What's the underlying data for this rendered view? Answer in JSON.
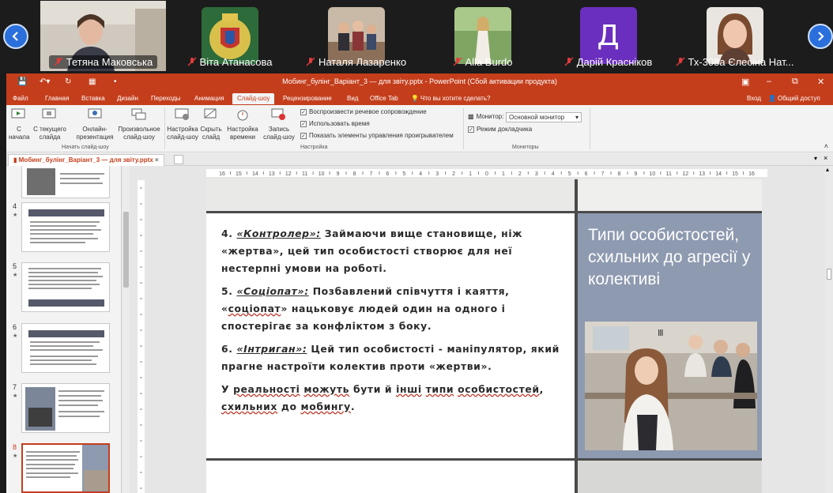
{
  "participants": [
    {
      "name": "Тетяна Маковська",
      "type": "video"
    },
    {
      "name": "Віта Атанасова",
      "type": "image"
    },
    {
      "name": "Наталя Лазаренко",
      "type": "image"
    },
    {
      "name": "Alla Burdo",
      "type": "image"
    },
    {
      "name": "Дарій Красніков",
      "type": "initial",
      "initial": "Д",
      "color": "#6b2fbf"
    },
    {
      "name": "Тх-308а Єлесіна Нат...",
      "type": "image"
    }
  ],
  "window": {
    "title": "Мобинг_булінг_Варіант_3 — для звіту.pptx - PowerPoint (Сбой активации продукта)",
    "accent": "#c43e1c"
  },
  "tabs": [
    "Файл",
    "Главная",
    "Вставка",
    "Дизайн",
    "Переходы",
    "Анимация",
    "Слайд-шоу",
    "Рецензирование",
    "Вид",
    "Office Tab"
  ],
  "active_tab": "Слайд-шоу",
  "tell_me": "Что вы хотите сделать?",
  "sign_in": "Вход",
  "share": "Общий доступ",
  "ribbon": {
    "from_start": "С начала",
    "from_start_l1": "С",
    "from_start_l2": "начала",
    "from_current_l1": "С текущего",
    "from_current_l2": "слайда",
    "online_l1": "Онлайн-",
    "online_l2": "презентация",
    "custom_l1": "Произвольное",
    "custom_l2": "слайд-шоу",
    "group_start": "Начать слайд-шоу",
    "setup_l1": "Настройка",
    "setup_l2": "слайд-шоу",
    "hide_l1": "Скрыть",
    "hide_l2": "слайд",
    "rehearse_l1": "Настройка",
    "rehearse_l2": "времени",
    "record_l1": "Запись",
    "record_l2": "слайд-шоу",
    "opt1": "Воспроизвести речевое сопровождение",
    "opt2": "Использовать время",
    "opt3": "Показать элементы управления проигрывателем",
    "group_setup": "Настройка",
    "monitor_label": "Монитор:",
    "monitor_value": "Основной монитор",
    "presenter": "Режим докладчика",
    "group_monitors": "Мониторы"
  },
  "doc_tab": "Мобинг_булінг_Варіант_3 — для звіту.pptx",
  "thumbnails": [
    {
      "num": "4",
      "selected": false
    },
    {
      "num": "5",
      "selected": false
    },
    {
      "num": "6",
      "selected": false
    },
    {
      "num": "7",
      "selected": false
    },
    {
      "num": "8",
      "selected": true
    }
  ],
  "ruler": [
    "16",
    "15",
    "14",
    "13",
    "12",
    "11",
    "10",
    "9",
    "8",
    "7",
    "6",
    "5",
    "4",
    "3",
    "2",
    "1",
    "0",
    "1",
    "2",
    "3",
    "4",
    "5",
    "6",
    "7",
    "8",
    "9",
    "10",
    "11",
    "12",
    "13",
    "14",
    "15",
    "16"
  ],
  "slide": {
    "title": "Типи особистостей, схильних до агресії у колективі",
    "p1_num": "4. ",
    "p1_term": "«Контролер»:",
    "p1_text": " Займаючи вище становище, ніж «жертва», цей тип особистості створює для неї нестерпні умови на роботі.",
    "p2_num": "5. ",
    "p2_term": "«Соціопат»:",
    "p2_text_a": " Позбавлений співчуття і каяття, «",
    "p2_word": "соціопат",
    "p2_text_b": "» нацьковує людей один на одного і спостерігає за конфліктом з боку.",
    "p3_num": "6. ",
    "p3_term": "«Інтриган»:",
    "p3_text": " Цей тип особистості - маніпулятор, який прагне настроїти колектив проти «жертви».",
    "p4_a": "У ",
    "p4_w1": "реальності",
    "p4_b": " ",
    "p4_w2": "можуть",
    "p4_c": " бути й ",
    "p4_w3": "інші",
    "p4_d": " ",
    "p4_w4": "типи",
    "p4_e": " ",
    "p4_w5": "особистостей",
    "p4_f": ", ",
    "p4_w6": "схильних",
    "p4_g": " до ",
    "p4_w7": "мобингу",
    "p4_h": "."
  }
}
